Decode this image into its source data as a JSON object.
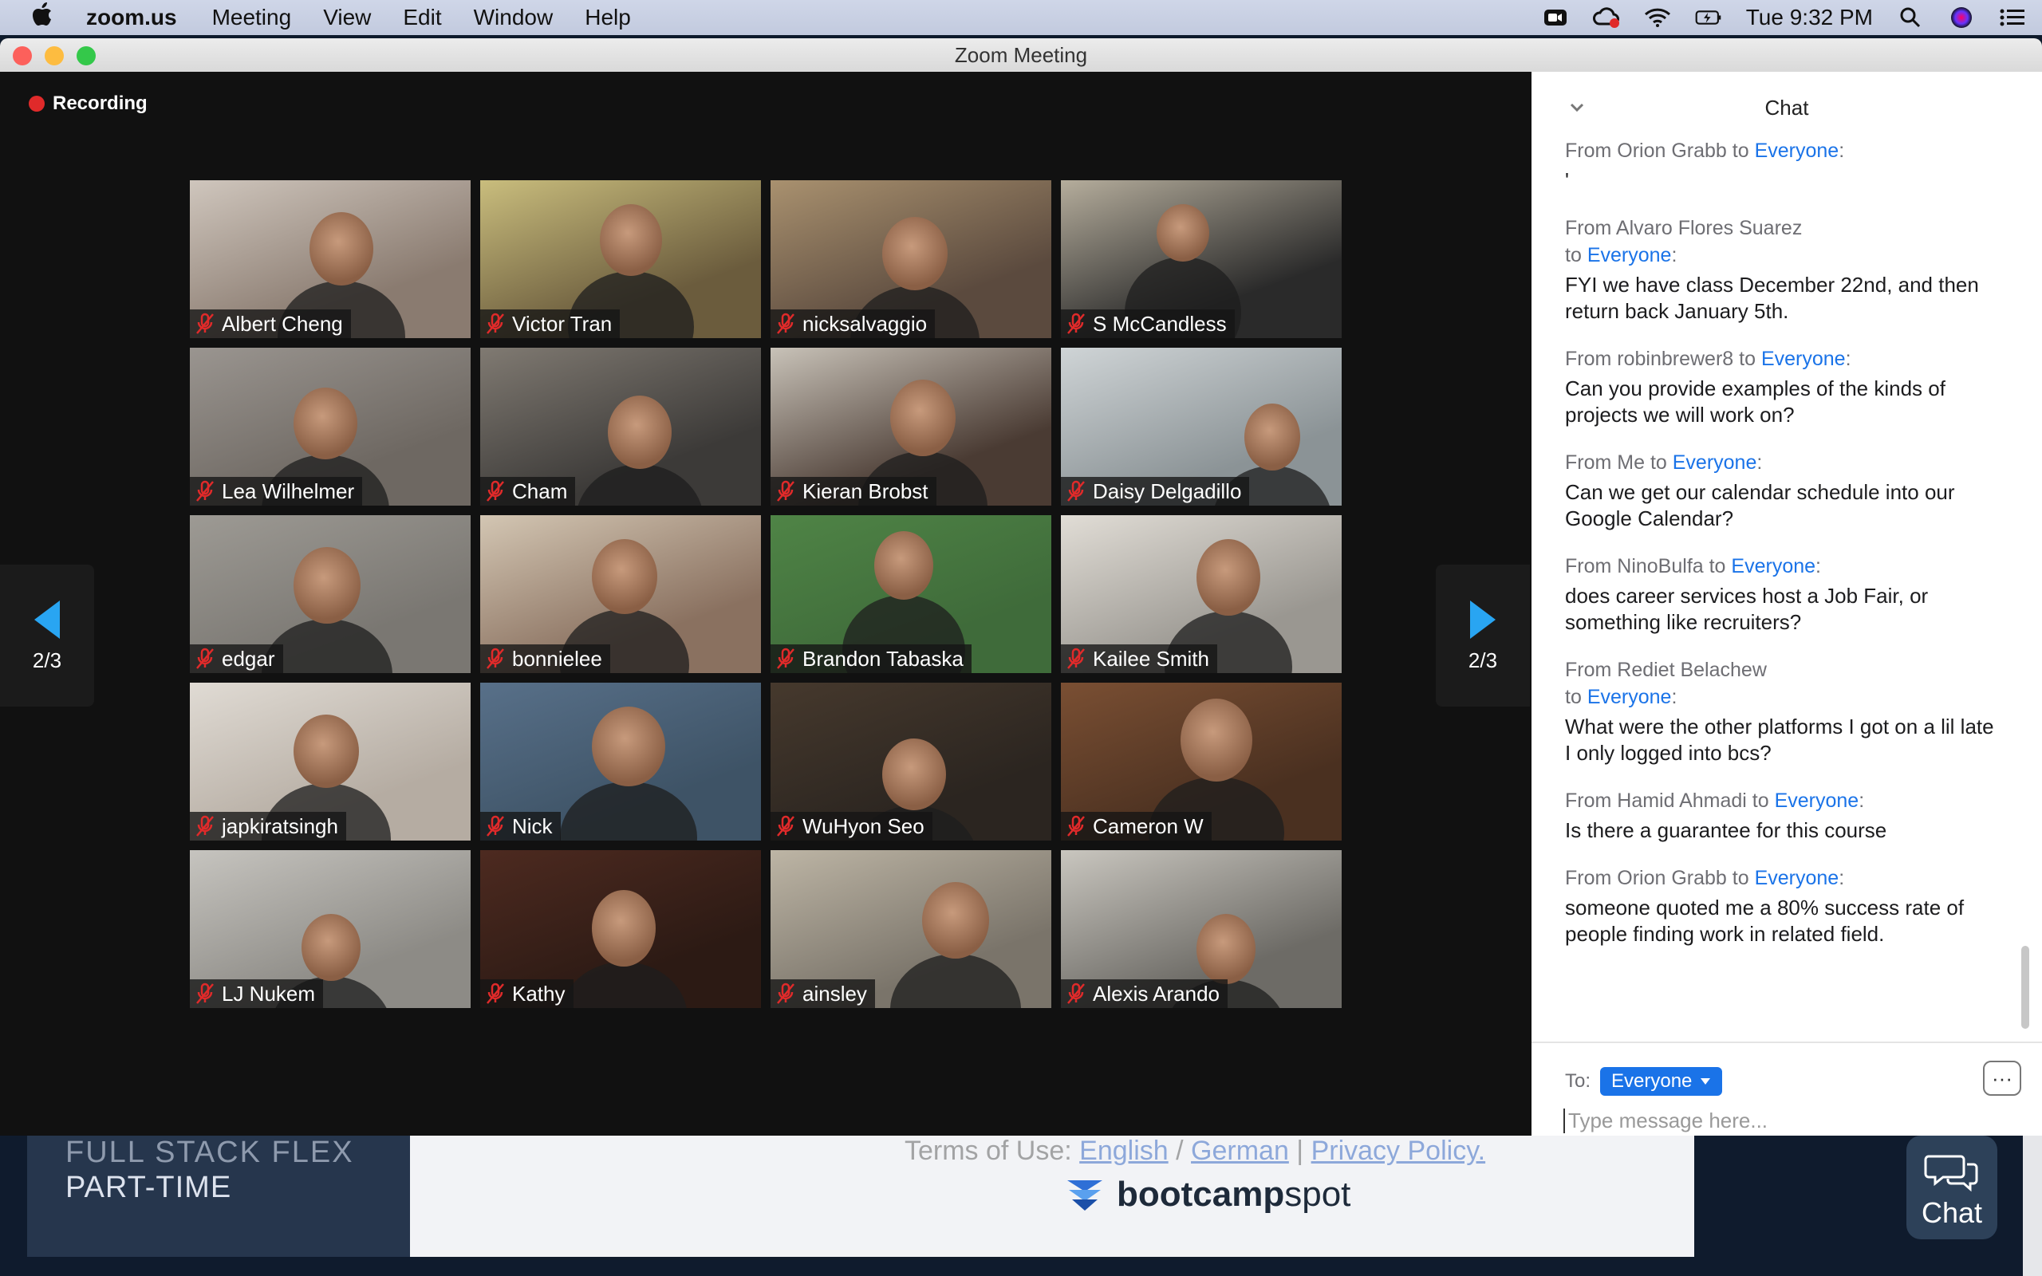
{
  "menubar": {
    "app_name": "zoom.us",
    "items": [
      "Meeting",
      "View",
      "Edit",
      "Window",
      "Help"
    ],
    "clock": "Tue 9:32 PM"
  },
  "window": {
    "title": "Zoom Meeting"
  },
  "recording": {
    "label": "Recording"
  },
  "pager": {
    "left": "2/3",
    "right": "2/3"
  },
  "participants": [
    {
      "name": "Albert Cheng",
      "bg": "#8a7b70",
      "wall": "#cfc6bd"
    },
    {
      "name": "Victor Tran",
      "bg": "#6b5c3d",
      "wall": "#c9bd7d"
    },
    {
      "name": "nicksalvaggio",
      "bg": "#5b4a3e",
      "wall": "#a9916f"
    },
    {
      "name": "S McCandless",
      "bg": "#2a2a2a",
      "wall": "#b5ad9c"
    },
    {
      "name": "Lea Wilhelmer",
      "bg": "#6e6862",
      "wall": "#9a9590"
    },
    {
      "name": "Cham",
      "bg": "#3c3a38",
      "wall": "#807a72"
    },
    {
      "name": "Kieran Brobst",
      "bg": "#4a3b33",
      "wall": "#c8c2b8"
    },
    {
      "name": "Daisy Delgadillo",
      "bg": "#8b9396",
      "wall": "#cfd4d6"
    },
    {
      "name": "edgar",
      "bg": "#7a7772",
      "wall": "#9d9a94"
    },
    {
      "name": "bonnielee",
      "bg": "#8a7160",
      "wall": "#d3c6b3"
    },
    {
      "name": "Brandon Tabaska",
      "bg": "#3f6b3a",
      "wall": "#4f8446"
    },
    {
      "name": "Kailee Smith",
      "bg": "#9a9791",
      "wall": "#e1ddd6"
    },
    {
      "name": "japkiratsingh",
      "bg": "#b5aca2",
      "wall": "#e0dbd4"
    },
    {
      "name": "Nick",
      "bg": "#3e5366",
      "wall": "#587089"
    },
    {
      "name": "WuHyon Seo",
      "bg": "#2b2520",
      "wall": "#46392d"
    },
    {
      "name": "Cameron W",
      "bg": "#4a3020",
      "wall": "#7a4f33"
    },
    {
      "name": "LJ Nukem",
      "bg": "#8d8b86",
      "wall": "#c6c4bf"
    },
    {
      "name": "Kathy",
      "bg": "#2c1a14",
      "wall": "#4d2a20"
    },
    {
      "name": "ainsley",
      "bg": "#7a746a",
      "wall": "#bdb5a5"
    },
    {
      "name": "Alexis Arando",
      "bg": "#6d6b66",
      "wall": "#c9c6bf"
    }
  ],
  "chat": {
    "title": "Chat",
    "messages": [
      {
        "sender": "From Orion Grabb to",
        "to": "Everyone",
        "sep": ":",
        "text": "'"
      },
      {
        "sender": "From Alvaro Flores Suarez",
        "sender2": "to",
        "to": "Everyone",
        "sep": ":",
        "text": "FYI we have class December 22nd, and then return back January 5th."
      },
      {
        "sender": "From robinbrewer8 to",
        "to": "Everyone",
        "sep": ":",
        "text": "Can you provide examples of the kinds of projects we will work on?"
      },
      {
        "sender": "From Me to",
        "to": "Everyone",
        "sep": ":",
        "text": "Can we get our calendar schedule into our Google Calendar?"
      },
      {
        "sender": "From NinoBulfa to",
        "to": "Everyone",
        "sep": ":",
        "text": "does career services host a Job Fair, or something like recruiters?"
      },
      {
        "sender": "From Rediet Belachew",
        "sender2": "to",
        "to": "Everyone",
        "sep": ":",
        "text": "What were the other platforms I  got on a lil late I only logged into bcs?"
      },
      {
        "sender": "From Hamid Ahmadi to",
        "to": "Everyone",
        "sep": ":",
        "text": "Is there a guarantee for this course"
      },
      {
        "sender": "From Orion Grabb to",
        "to": "Everyone",
        "sep": ":",
        "text": "someone quoted me a 80% success rate of people finding work in related field."
      }
    ],
    "to_label": "To:",
    "to_value": "Everyone",
    "more_label": "···",
    "input_placeholder": "Type message here..."
  },
  "background_page": {
    "sidebar_line1": "FULL STACK FLEX",
    "sidebar_line2": "PART-TIME",
    "terms_prefix": "Terms of Use: ",
    "terms_english": "English",
    "terms_sep1": " / ",
    "terms_german": "German",
    "terms_sep2": " | ",
    "terms_privacy": "Privacy Policy.",
    "logo_text_bold": "bootcamp",
    "logo_text": "spot",
    "chat_button": "Chat"
  },
  "colors": {
    "accent": "#1a73e8",
    "recording": "#e02a2a",
    "mute": "#e02a2a"
  }
}
